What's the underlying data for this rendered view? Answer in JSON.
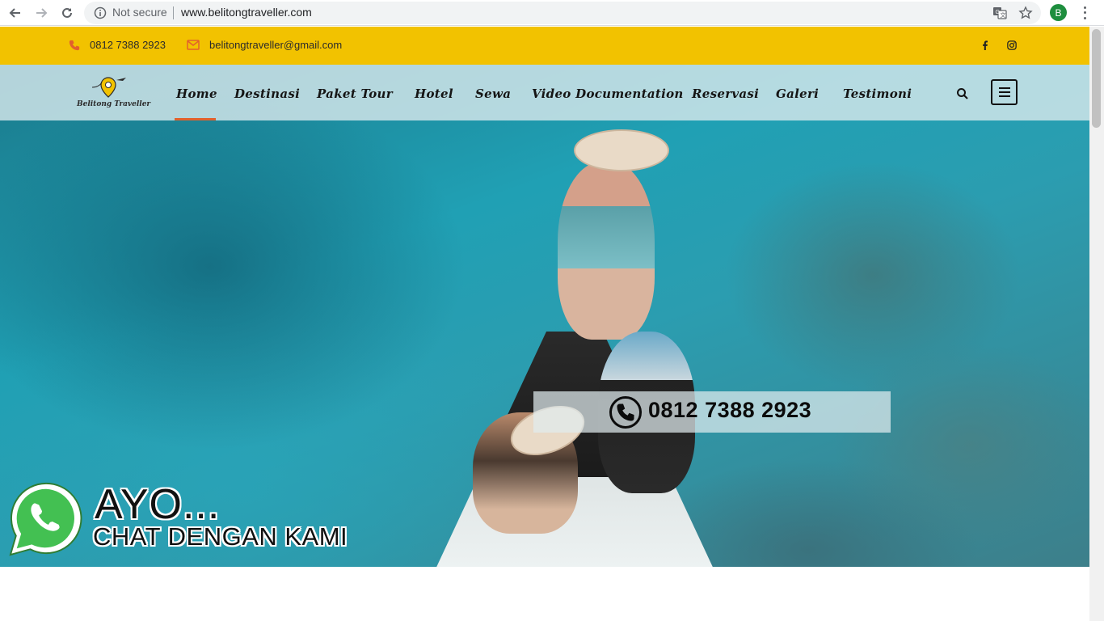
{
  "browser": {
    "security_label": "Not secure",
    "url": "www.belitongtraveller.com",
    "profile_initial": "B",
    "icons": [
      "back-icon",
      "forward-icon",
      "reload-icon",
      "info-icon",
      "translate-icon",
      "star-icon",
      "kebab-menu-icon"
    ]
  },
  "topbar": {
    "phone": "0812 7388 2923",
    "email": "belitongtraveller@gmail.com",
    "accent_color": "#f2c200",
    "icon_color": "#e2612c",
    "social": [
      "facebook-icon",
      "instagram-icon"
    ]
  },
  "header": {
    "logo_text": "Belitong Traveller",
    "menu": [
      {
        "label": "Home",
        "active": true
      },
      {
        "label": "Destinasi"
      },
      {
        "label": "Paket Tour"
      },
      {
        "label": "Hotel"
      },
      {
        "label": "Sewa"
      },
      {
        "label": "Video Documentation"
      },
      {
        "label": "Reservasi"
      },
      {
        "label": "Galeri"
      },
      {
        "label": "Testimoni"
      }
    ],
    "active_color": "#e2612c"
  },
  "hero": {
    "phone_banner": "0812 7388 2923",
    "cta_title": "AYO...",
    "cta_subtitle": "CHAT DENGAN KAMI"
  }
}
